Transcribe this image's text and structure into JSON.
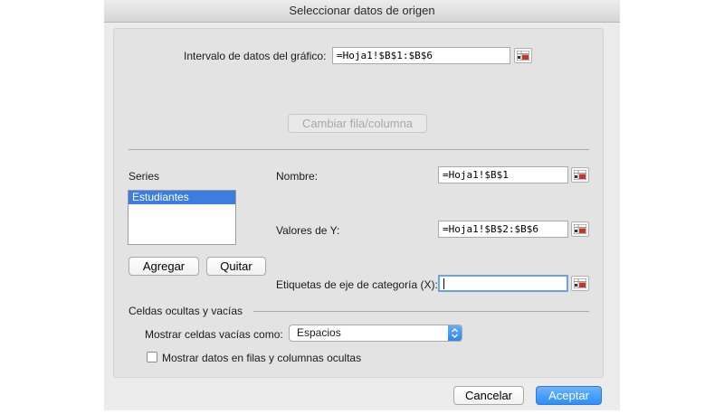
{
  "window": {
    "title": "Seleccionar datos de origen"
  },
  "range": {
    "label": "Intervalo de datos del gráfico:",
    "value": "=Hoja1!$B$1:$B$6"
  },
  "switch_button": {
    "label": "Cambiar fila/columna",
    "enabled": false
  },
  "series": {
    "label": "Series",
    "items": [
      "Estudiantes"
    ],
    "selected": "Estudiantes",
    "add_label": "Agregar",
    "remove_label": "Quitar"
  },
  "name_field": {
    "label": "Nombre:",
    "value": "=Hoja1!$B$1"
  },
  "y_values": {
    "label": "Valores de Y:",
    "value": "=Hoja1!$B$2:$B$6"
  },
  "x_labels": {
    "label": "Etiquetas de eje de categoría (X):",
    "value": ""
  },
  "hidden": {
    "section_label": "Celdas ocultas y vacías",
    "empty_label": "Mostrar celdas vacías como:",
    "empty_value": "Espacios",
    "checkbox_label": "Mostrar datos en filas y columnas ocultas",
    "checkbox_checked": false
  },
  "footer": {
    "cancel_label": "Cancelar",
    "ok_label": "Aceptar"
  },
  "colors": {
    "accent": "#2a8ffa",
    "selection": "#3b7ee0"
  },
  "icons": {
    "range_selector": "collapse-dialog-icon",
    "select_arrows": "updown-chevron-icon"
  }
}
